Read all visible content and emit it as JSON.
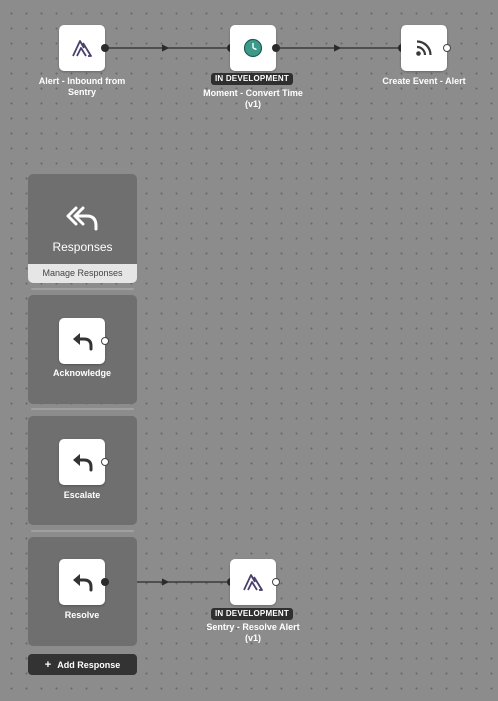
{
  "workflow": {
    "nodes": [
      {
        "id": "alert-inbound",
        "icon": "sentry-icon",
        "label": "Alert - Inbound from Sentry"
      },
      {
        "id": "moment-convert",
        "icon": "clock-icon",
        "badge": "IN DEVELOPMENT",
        "label": "Moment - Convert Time (v1)"
      },
      {
        "id": "create-event",
        "icon": "rss-icon",
        "label": "Create Event - Alert"
      },
      {
        "id": "sentry-resolve",
        "icon": "sentry-icon",
        "badge": "IN DEVELOPMENT",
        "label": "Sentry - Resolve Alert (v1)"
      }
    ]
  },
  "responses": {
    "title": "Responses",
    "header_icon": "double-reply-icon",
    "manage_label": "Manage Responses",
    "items": [
      {
        "label": "Acknowledge",
        "icon": "reply-icon"
      },
      {
        "label": "Escalate",
        "icon": "reply-icon"
      },
      {
        "label": "Resolve",
        "icon": "reply-icon"
      }
    ],
    "add_label": "Add Response"
  },
  "colors": {
    "canvas": "#8c8c8c",
    "panel": "#6f6f6f",
    "badge": "#2f2f2f",
    "clock_accent": "#3d9a8b",
    "sentry_icon": "#4a3f6b"
  }
}
